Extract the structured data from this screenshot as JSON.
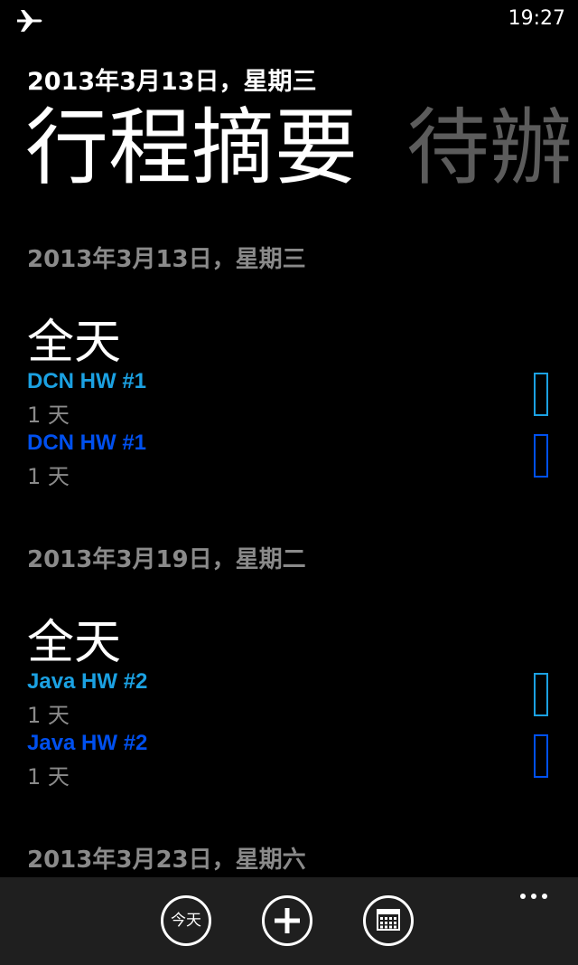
{
  "status_bar": {
    "time": "19:27",
    "airplane_icon": "airplane-icon"
  },
  "pivot": {
    "subtitle": "2013年3月13日，星期三",
    "headers": [
      "行程摘要",
      "待辦"
    ]
  },
  "agenda": [
    {
      "date": "2013年3月13日，星期三",
      "allday_label": "全天",
      "events": [
        {
          "title": "DCN HW #1",
          "duration": "1 天",
          "color": "#1ba1e2"
        },
        {
          "title": "DCN HW #1",
          "duration": "1 天",
          "color": "#0050ef"
        }
      ]
    },
    {
      "date": "2013年3月19日，星期二",
      "allday_label": "全天",
      "events": [
        {
          "title": "Java HW #2",
          "duration": "1 天",
          "color": "#1ba1e2"
        },
        {
          "title": "Java HW #2",
          "duration": "1 天",
          "color": "#0050ef"
        }
      ]
    },
    {
      "date": "2013年3月23日，星期六"
    }
  ],
  "app_bar": {
    "today_label": "今天",
    "buttons": [
      "today-button",
      "add-button",
      "calendar-button"
    ],
    "more_icon": "more-icon",
    "background": "#1f1f1f"
  },
  "colors": {
    "background": "#000000",
    "secondary_text": "#8a8a8a",
    "inactive_pivot": "#5c5c5c",
    "accent_light": "#1ba1e2",
    "accent_dark": "#0050ef"
  }
}
